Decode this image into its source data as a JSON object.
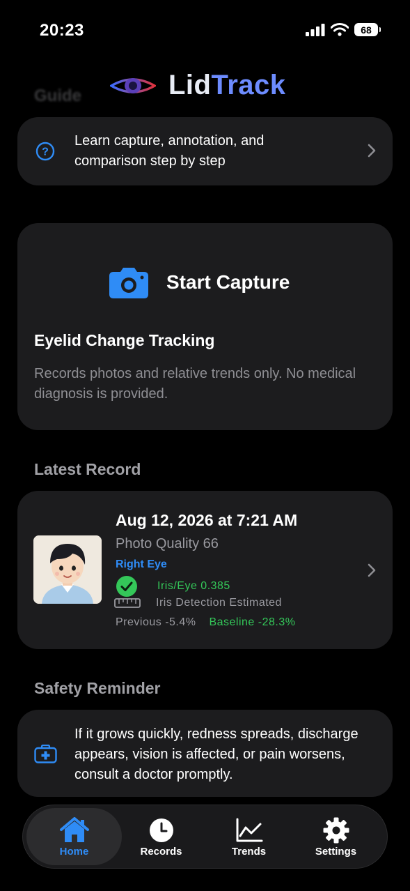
{
  "status_bar": {
    "time": "20:23",
    "battery": "68"
  },
  "header": {
    "app_name_part1": "Lid",
    "app_name_part2": "Track",
    "ghost_section": "Guide"
  },
  "guide_card": {
    "text": "Learn capture, annotation, and comparison step by step"
  },
  "capture_card": {
    "button_label": "Start Capture",
    "title": "Eyelid Change Tracking",
    "subtitle": "Records photos and relative trends only. No medical diagnosis is provided."
  },
  "latest_record": {
    "section_title": "Latest Record",
    "date": "Aug 12, 2026 at 7:21 AM",
    "photo_quality": "Photo Quality 66",
    "eye": "Right Eye",
    "iris_ratio": "Iris/Eye 0.385",
    "iris_detection": "Iris Detection Estimated",
    "previous": "Previous -5.4%",
    "baseline": "Baseline -28.3%"
  },
  "safety": {
    "section_title": "Safety Reminder",
    "text": "If it grows quickly, redness spreads, discharge appears, vision is affected, or pain worsens, consult a doctor promptly."
  },
  "tabbar": {
    "tabs": [
      {
        "label": "Home",
        "icon": "house-icon",
        "active": true
      },
      {
        "label": "Records",
        "icon": "clock-icon",
        "active": false
      },
      {
        "label": "Trends",
        "icon": "line-chart-icon",
        "active": false
      },
      {
        "label": "Settings",
        "icon": "gear-icon",
        "active": false
      }
    ]
  },
  "colors": {
    "accent": "#2f8cf6",
    "positive": "#34c759",
    "card": "#1c1c1e",
    "background": "#000000",
    "secondary_text": "#8e8e93"
  }
}
